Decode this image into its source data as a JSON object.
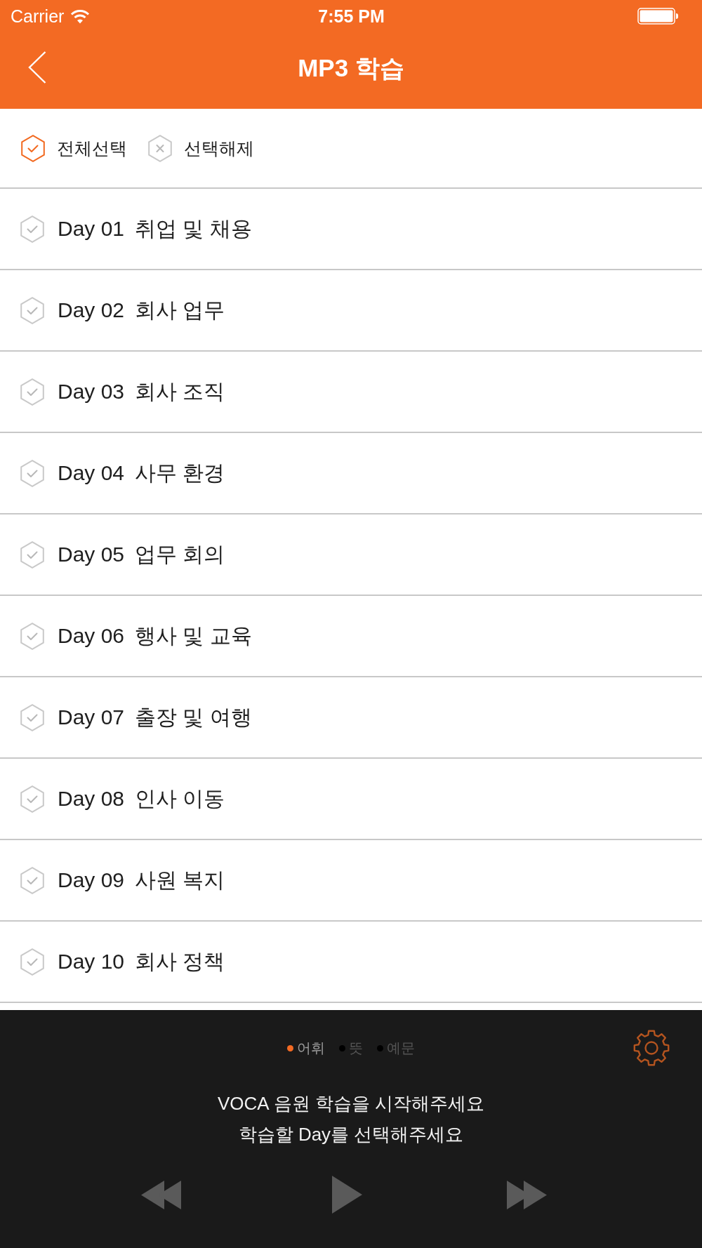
{
  "status_bar": {
    "carrier": "Carrier",
    "time": "7:55 PM"
  },
  "nav": {
    "title": "MP3 학습"
  },
  "selection_actions": [
    {
      "kind": "select_all",
      "label": "전체선택",
      "active": true
    },
    {
      "kind": "clear",
      "label": "선택해제",
      "active": false
    }
  ],
  "days": [
    {
      "day": "Day 01",
      "title": "취업 및 채용",
      "checked": false
    },
    {
      "day": "Day 02",
      "title": "회사 업무",
      "checked": false
    },
    {
      "day": "Day 03",
      "title": "회사 조직",
      "checked": false
    },
    {
      "day": "Day 04",
      "title": "사무 환경",
      "checked": false
    },
    {
      "day": "Day 05",
      "title": "업무 회의",
      "checked": false
    },
    {
      "day": "Day 06",
      "title": "행사 및 교육",
      "checked": false
    },
    {
      "day": "Day 07",
      "title": "출장 및 여행",
      "checked": false
    },
    {
      "day": "Day 08",
      "title": "인사 이동",
      "checked": false
    },
    {
      "day": "Day 09",
      "title": "사원 복지",
      "checked": false
    },
    {
      "day": "Day 10",
      "title": "회사 정책",
      "checked": false
    }
  ],
  "player": {
    "modes": [
      {
        "label": "어휘",
        "selected": true
      },
      {
        "label": "뜻",
        "selected": false
      },
      {
        "label": "예문",
        "selected": false
      }
    ],
    "messages": [
      "VOCA 음원 학습을 시작해주세요",
      "학습할 Day를 선택해주세요"
    ]
  }
}
